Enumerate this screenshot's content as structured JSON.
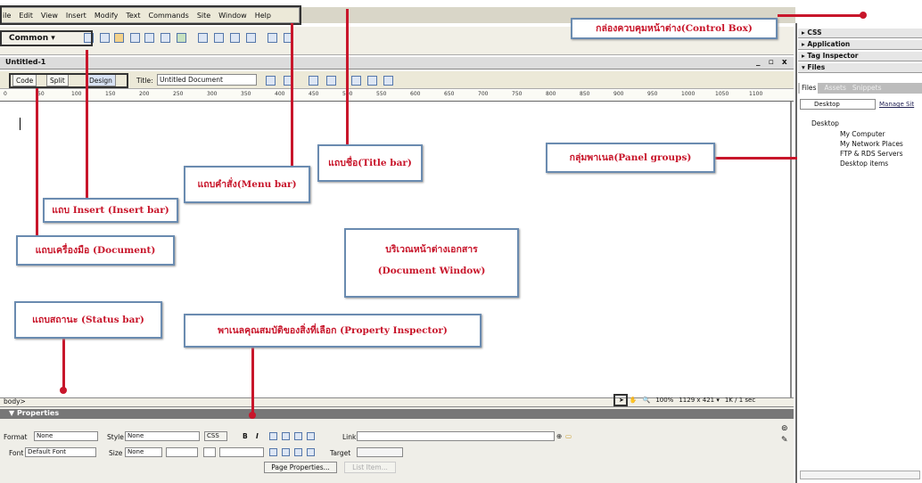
{
  "menubar": {
    "items": [
      "ile",
      "Edit",
      "View",
      "Insert",
      "Modify",
      "Text",
      "Commands",
      "Site",
      "Window",
      "Help"
    ]
  },
  "insert_bar": {
    "category": "Common ▾"
  },
  "document": {
    "tab": "Untitled-1",
    "window_controls": "_ ▫ x",
    "views": {
      "code": "Code",
      "split": "Split",
      "design": "Design"
    },
    "title_label": "Title:",
    "title_value": "Untitled Document",
    "ruler_ticks": [
      "0",
      "50",
      "100",
      "150",
      "200",
      "250",
      "300",
      "350",
      "400",
      "450",
      "500",
      "550",
      "600",
      "650",
      "700",
      "750",
      "800",
      "850",
      "900",
      "950",
      "1000",
      "1050",
      "1100"
    ]
  },
  "status_bar": {
    "tag": "body>",
    "zoom": "100%",
    "size": "1129 x 421 ▾",
    "weight": "1K / 1 sec"
  },
  "properties": {
    "title": "▼ Properties",
    "format_label": "Format",
    "format_value": "None",
    "style_label": "Style",
    "style_value": "None",
    "css_btn": "CSS",
    "bold": "B",
    "italic": "I",
    "link_label": "Link",
    "font_label": "Font",
    "font_value": "Default Font",
    "size_label": "Size",
    "size_value": "None",
    "target_label": "Target",
    "page_props_btn": "Page Properties...",
    "list_items_btn": "List Item..."
  },
  "panels": {
    "css": "▸ CSS",
    "application": "▸ Application",
    "tag_inspector": "▸ Tag Inspector",
    "files": "▾ Files",
    "tabs": [
      "Files",
      "Assets",
      "Snippets"
    ],
    "site_select": "Desktop",
    "manage_sites": "Manage Sit",
    "tree": [
      "Desktop",
      "My Computer",
      "My Network Places",
      "FTP & RDS Servers",
      "Desktop items"
    ]
  },
  "callouts": {
    "control_box": "กล่องควบคุมหน้าต่าง(Control Box)",
    "panel_groups": "กลุ่มพาเนล(Panel groups)",
    "title_bar": "แถบชื่อ(Title bar)",
    "menu_bar": "แถบคำสั่ง(Menu bar)",
    "insert_bar": "แถบ Insert (Insert bar)",
    "document_toolbar": "แถบเครื่องมือ (Document)",
    "document_window_1": "บริเวณหน้าต่างเอกสาร",
    "document_window_2": "(Document Window)",
    "status_bar": "แถบสถานะ (Status bar)",
    "property_inspector": "พาเนลคุณสมบัติของสิ่งที่เลือก (Property Inspector)"
  }
}
